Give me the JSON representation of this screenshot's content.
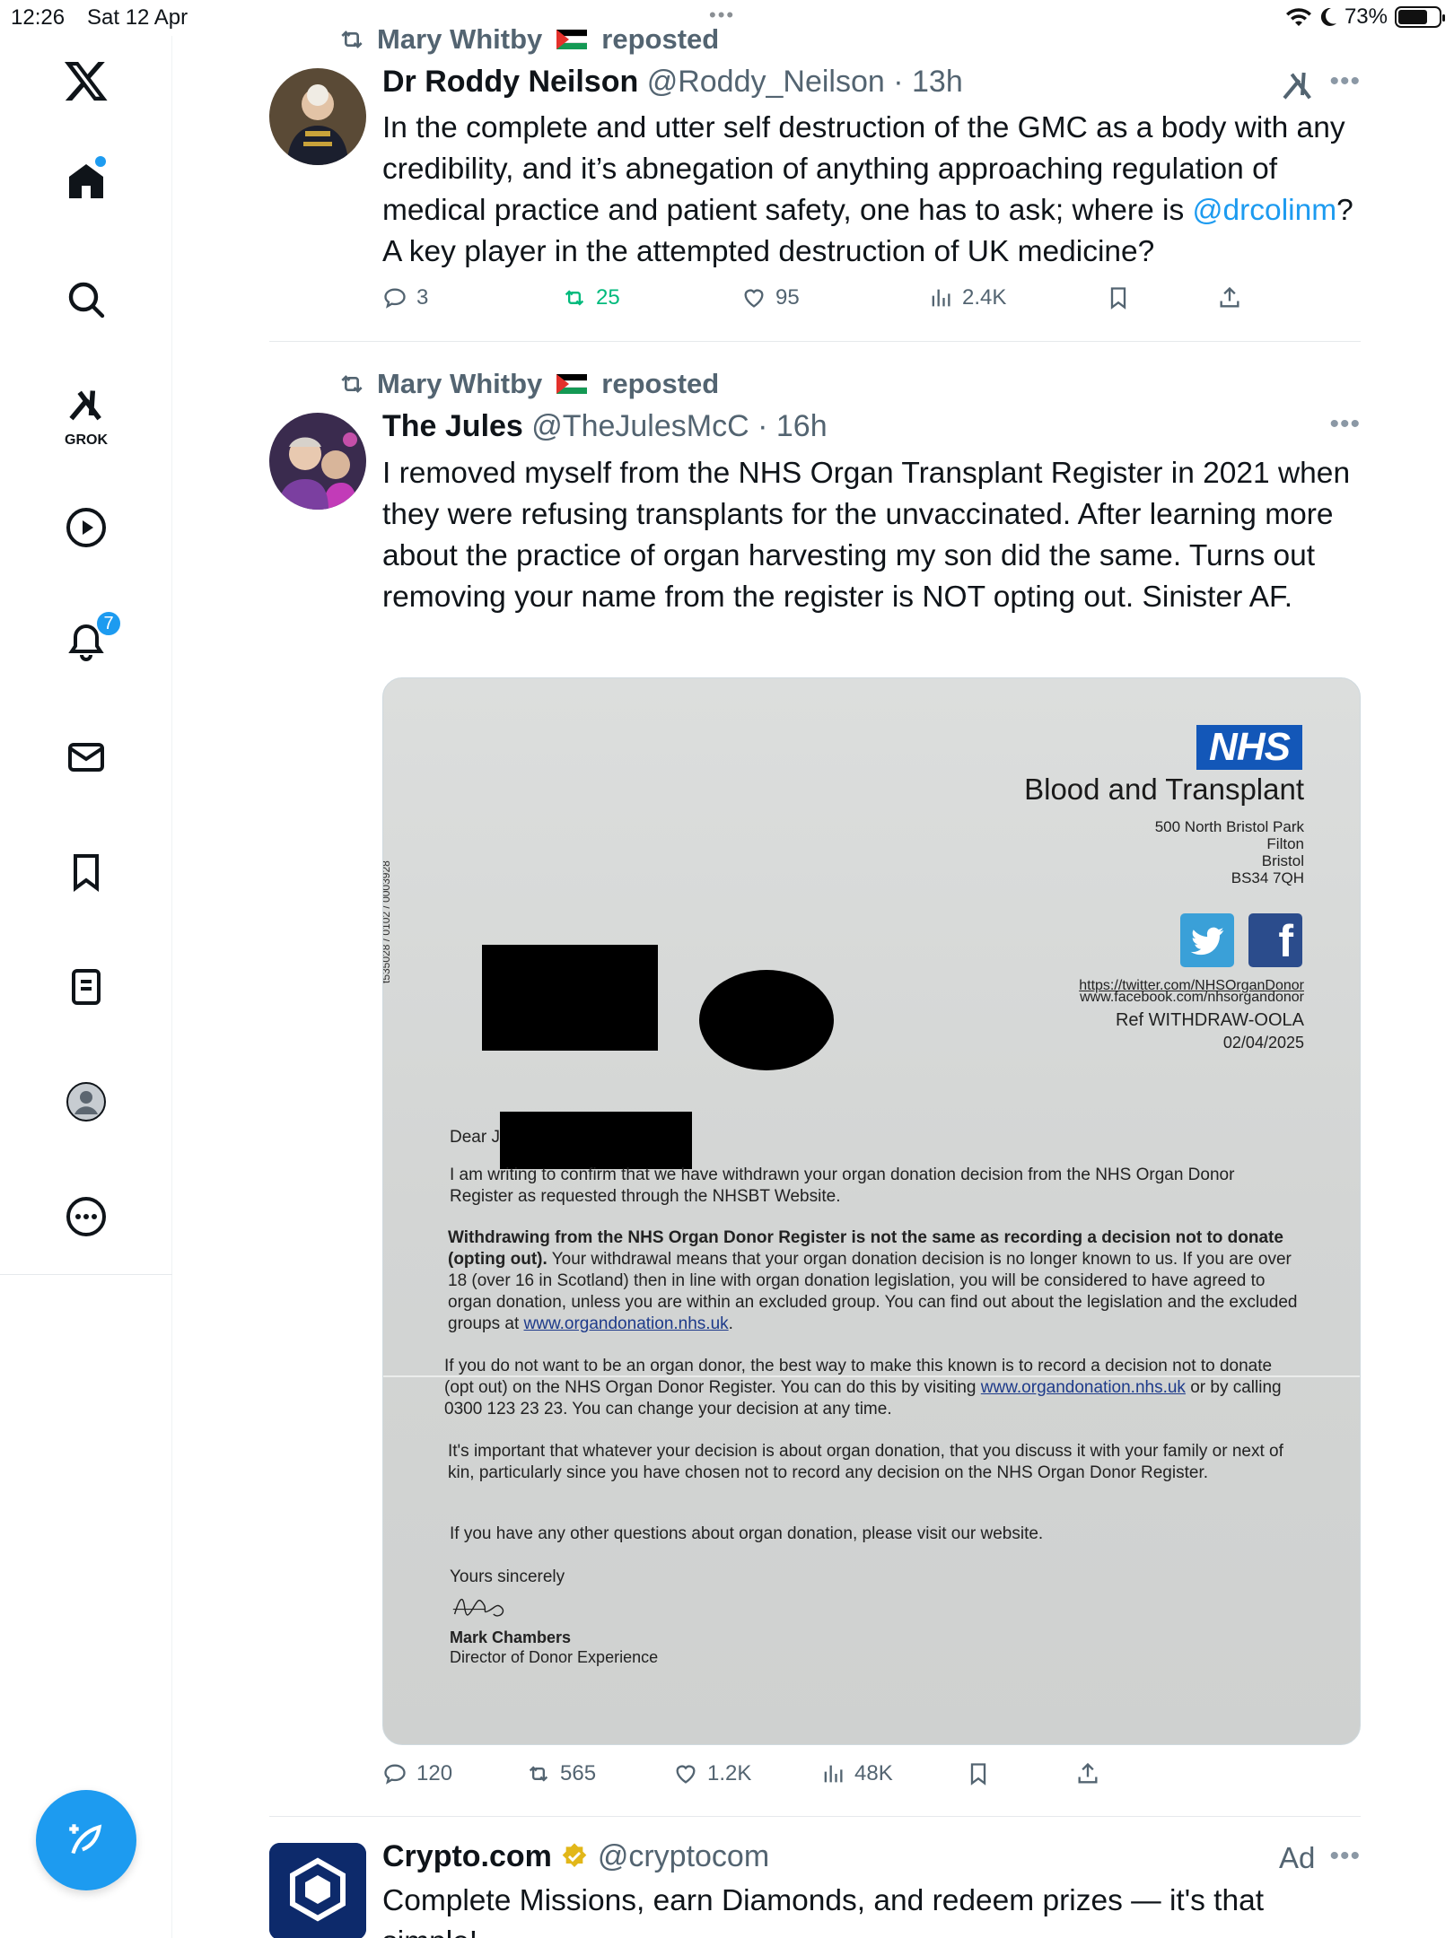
{
  "status_bar": {
    "time": "12:26",
    "date": "Sat 12 Apr",
    "battery_percent": "73%",
    "battery_level": 0.73
  },
  "sidebar": {
    "items": [
      {
        "name": "x-logo",
        "icon": "x-logo-icon"
      },
      {
        "name": "home",
        "icon": "home-icon"
      },
      {
        "name": "explore",
        "icon": "search-icon"
      },
      {
        "name": "grok",
        "icon": "grok-icon",
        "label": "GROK"
      },
      {
        "name": "video",
        "icon": "play-icon"
      },
      {
        "name": "notifications",
        "icon": "bell-icon",
        "badge": "7"
      },
      {
        "name": "messages",
        "icon": "mail-icon"
      },
      {
        "name": "bookmarks",
        "icon": "bookmark-icon"
      },
      {
        "name": "lists",
        "icon": "list-icon"
      },
      {
        "name": "profile",
        "icon": "profile-icon"
      },
      {
        "name": "more",
        "icon": "more-icon"
      }
    ],
    "compose": "compose-icon"
  },
  "tweets": [
    {
      "reposted_by": "Mary Whitby",
      "repost_suffix": "reposted",
      "name": "Dr Roddy Neilson",
      "handle": "@Roddy_Neilson",
      "time": "13h",
      "text_before": "In the complete and utter self destruction of the GMC as a body with any credibility, and it’s abnegation of anything approaching regulation of medical practice and patient safety, one has to ask; where is ",
      "mention": "@drcolinm",
      "text_after": "? A key player in the attempted destruction of UK medicine?",
      "replies": "3",
      "reposts": "25",
      "likes": "95",
      "views": "2.4K"
    },
    {
      "reposted_by": "Mary Whitby",
      "repost_suffix": "reposted",
      "name": "The Jules",
      "handle": "@TheJulesMcC",
      "time": "16h",
      "text": "I removed myself from the NHS Organ Transplant Register in 2021 when they were refusing transplants for the unvaccinated. After learning more about the practice of organ harvesting my son did the same. Turns out removing your name from the register is NOT opting out. Sinister AF.",
      "replies": "120",
      "reposts": "565",
      "likes": "1.2K",
      "views": "48K",
      "letter": {
        "logo": "NHS",
        "org": "Blood and Transplant",
        "address": [
          "500 North Bristol Park",
          "Filton",
          "Bristol",
          "BS34 7QH"
        ],
        "links": [
          "https://twitter.com/NHSOrganDonor",
          "www.facebook.com/nhsorgandonor"
        ],
        "ref": "Ref WITHDRAW-OOLA",
        "date": "02/04/2025",
        "side_code": "t535028 / 0102 / 0003928",
        "salutation": "Dear J",
        "p1": "I am writing to confirm that we have withdrawn your organ donation decision from the NHS Organ Donor Register as requested through the NHSBT Website.",
        "p2_bold": "Withdrawing from the NHS Organ Donor Register is not the same as recording a decision not to donate (opting out).",
        "p2_rest": " Your withdrawal means that your organ donation decision is no longer known to us. If you are over 18 (over 16 in Scotland) then in line with organ donation legislation, you will be considered to have agreed to organ donation, unless you are within an excluded group. You can find out about the legislation and the excluded groups at ",
        "p2_link": "www.organdonation.nhs.uk",
        "p2_end": ".",
        "p3_start": "If you do not want to be an organ donor, the best way to make this known is to record a decision not to donate (opt out) on the NHS Organ Donor Register. You can do this by visiting ",
        "p3_link": "www.organdonation.nhs.uk",
        "p3_end": " or by calling 0300 123 23 23. You can change your decision at any time.",
        "p4": "It's important that whatever your decision is about organ donation, that you discuss it with your family or next of kin, particularly since you have chosen not to record any decision on the NHS Organ Donor Register.",
        "p5": "If you have any other questions about organ donation, please visit our website.",
        "closing": "Yours sincerely",
        "signer": "Mark Chambers",
        "signer_title": "Director of Donor Experience"
      }
    },
    {
      "name": "Crypto.com",
      "handle": "@cryptocom",
      "ad_label": "Ad",
      "text": "Complete Missions, earn Diamonds, and redeem prizes — it's that simple!"
    }
  ]
}
